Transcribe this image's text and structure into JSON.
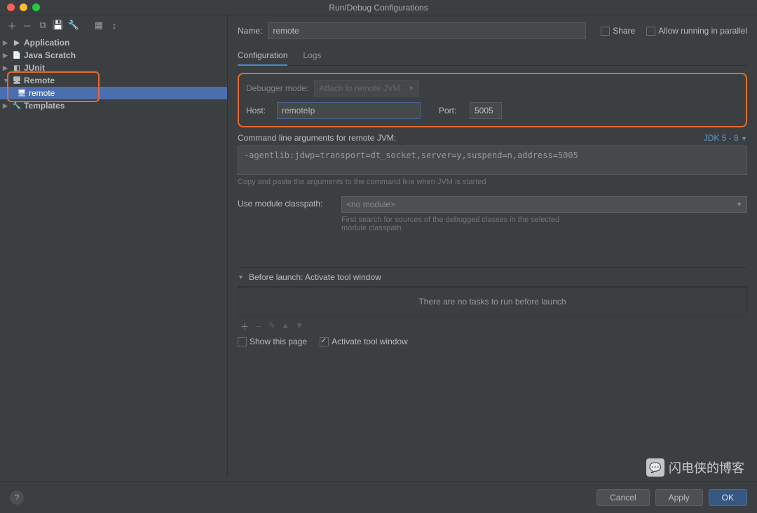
{
  "window": {
    "title": "Run/Debug Configurations"
  },
  "toolbar": {
    "add": "＋",
    "remove": "－",
    "copy": "⧉",
    "save": "💾",
    "wrench": "🔧",
    "folder": "▦",
    "sort": "↕"
  },
  "tree": {
    "items": [
      {
        "label": "Application"
      },
      {
        "label": "Java Scratch"
      },
      {
        "label": "JUnit"
      },
      {
        "label": "Remote"
      },
      {
        "label": "Templates"
      }
    ],
    "remote_child": "remote"
  },
  "form": {
    "name_label": "Name:",
    "name_value": "remote",
    "share_label": "Share",
    "allow_parallel_label": "Allow running in parallel",
    "tabs": [
      "Configuration",
      "Logs"
    ],
    "debugger_mode_label": "Debugger mode:",
    "debugger_mode_value": "Attach to remote JVM",
    "host_label": "Host:",
    "host_value": "remoteIp",
    "port_label": "Port:",
    "port_value": "5005",
    "cli_label": "Command line arguments for remote JVM:",
    "jdk_link": "JDK 5 - 8",
    "cli_value": "-agentlib:jdwp=transport=dt_socket,server=y,suspend=n,address=5005",
    "cli_hint": "Copy and paste the arguments to the command line when JVM is started",
    "module_label": "Use module classpath:",
    "module_value": "<no module>",
    "module_hint": "First search for sources of the debugged classes in the selected module classpath",
    "before_launch_title": "Before launch: Activate tool window",
    "no_tasks": "There are no tasks to run before launch",
    "show_page_label": "Show this page",
    "activate_tool_label": "Activate tool window"
  },
  "footer": {
    "cancel": "Cancel",
    "apply": "Apply",
    "ok": "OK"
  },
  "watermark": "闪电侠的博客"
}
